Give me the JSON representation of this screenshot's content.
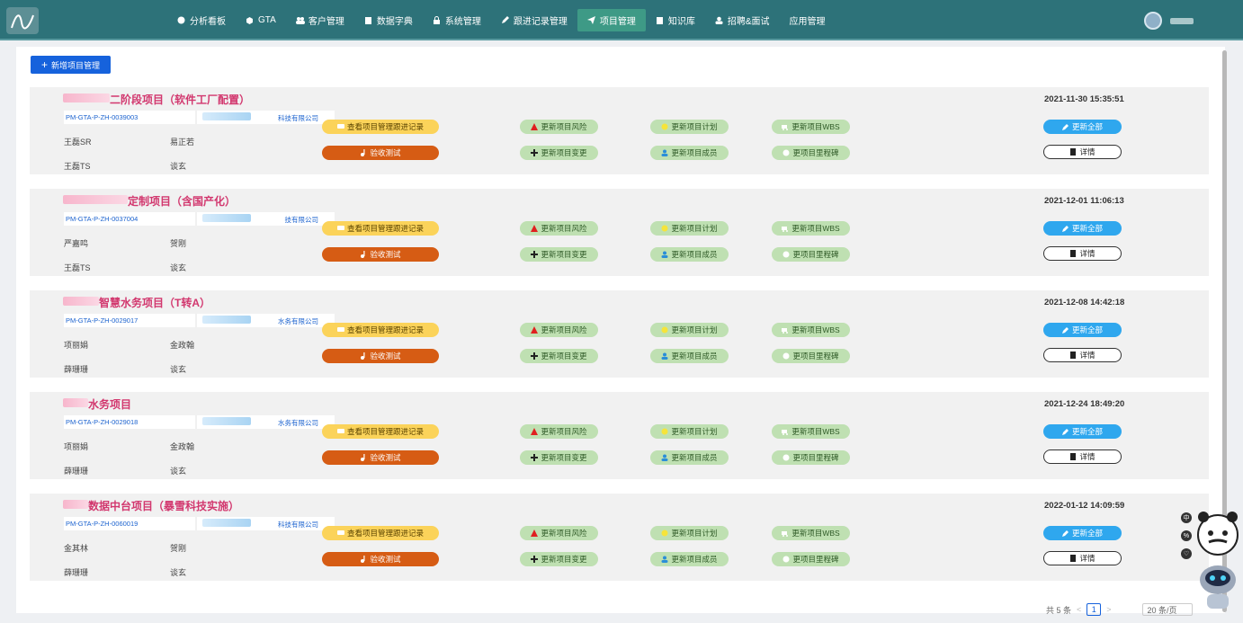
{
  "nav": {
    "items": [
      {
        "label": "分析看板",
        "icon": "dashboard-icon",
        "active": false
      },
      {
        "label": "GTA",
        "icon": "cube-icon",
        "active": false
      },
      {
        "label": "客户管理",
        "icon": "users-icon",
        "active": false
      },
      {
        "label": "数据字典",
        "icon": "book-icon",
        "active": false
      },
      {
        "label": "系统管理",
        "icon": "lock-icon",
        "active": false
      },
      {
        "label": "跟进记录管理",
        "icon": "pencil-icon",
        "active": false
      },
      {
        "label": "项目管理",
        "icon": "send-icon",
        "active": true
      },
      {
        "label": "知识库",
        "icon": "book-icon",
        "active": false
      },
      {
        "label": "招聘&面试",
        "icon": "user-icon",
        "active": false
      },
      {
        "label": "应用管理",
        "icon": "",
        "active": false
      }
    ]
  },
  "toolbar": {
    "add_label": "新增项目管理"
  },
  "actions": {
    "view_followup": "查看项目管理跟进记录",
    "acceptance": "验收测试",
    "update_risk": "更新项目风险",
    "update_change": "更新项目变更",
    "update_plan": "更新项目计划",
    "update_members": "更新项目成员",
    "update_wbs": "更新项目WBS",
    "update_milestone": "更项目里程碑",
    "update_all": "更新全部",
    "details": "详情"
  },
  "projects": [
    {
      "title": "二阶段项目（软件工厂配置）",
      "code": "PM-GTA-P-ZH-0039003",
      "org": "科技有限公司",
      "person1": "王磊SR",
      "person2": "易正若",
      "person3": "王磊TS",
      "person4": "谈玄",
      "time": "2021-11-30 15:35:51"
    },
    {
      "title": "定制项目（含国产化）",
      "code": "PM-GTA-P-ZH-0037004",
      "org": "技有限公司",
      "person1": "严嘉鸣",
      "person2": "贺刚",
      "person3": "王磊TS",
      "person4": "谈玄",
      "time": "2021-12-01 11:06:13"
    },
    {
      "title": "智慧水务项目（T转A）",
      "code": "PM-GTA-P-ZH-0029017",
      "org": "水务有限公司",
      "person1": "项丽娟",
      "person2": "金政翰",
      "person3": "薛珊珊",
      "person4": "谈玄",
      "time": "2021-12-08 14:42:18"
    },
    {
      "title": "水务项目",
      "code": "PM-GTA-P-ZH-0029018",
      "org": "水务有限公司",
      "person1": "项丽娟",
      "person2": "金政翰",
      "person3": "薛珊珊",
      "person4": "谈玄",
      "time": "2021-12-24 18:49:20"
    },
    {
      "title": "数据中台项目（暴雪科技实施）",
      "code": "PM-GTA-P-ZH-0060019",
      "org": "科技有限公司",
      "person1": "金其林",
      "person2": "贺刚",
      "person3": "薛珊珊",
      "person4": "谈玄",
      "time": "2022-01-12 14:09:59"
    }
  ],
  "pager": {
    "total": "共 5 条",
    "page": "1",
    "size": "20 条/页",
    "prev": "<",
    "next": ">"
  },
  "assistant": {
    "lang": "中",
    "b2": "%",
    "b3": "♡"
  }
}
